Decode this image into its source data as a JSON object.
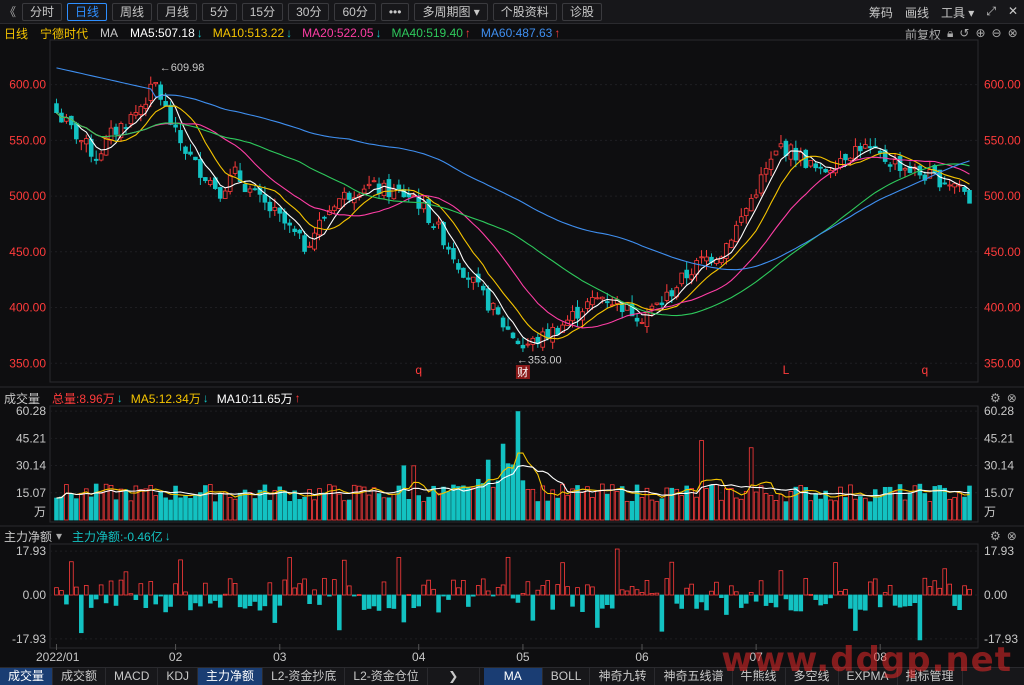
{
  "toolbar": {
    "back": "《",
    "buttons": [
      "分时",
      "日线",
      "周线",
      "月线",
      "5分",
      "15分",
      "30分",
      "60分",
      "•••",
      "多周期图",
      "个股资料",
      "诊股"
    ],
    "active": "日线",
    "right": [
      "筹码",
      "画线",
      "工具"
    ]
  },
  "main_legend": {
    "period": "日线",
    "name": "宁德时代",
    "ma": "MA",
    "ma5": "MA5:507.18",
    "ma10": "MA10:513.22",
    "ma20": "MA20:522.05",
    "ma40": "MA40:519.40",
    "ma60": "MA60:487.63",
    "adjust": "前复权"
  },
  "vol_legend": {
    "name": "成交量",
    "total": "总量:8.96万",
    "ma5": "MA5:12.34万",
    "ma10": "MA10:11.65万"
  },
  "flow_legend": {
    "name": "主力净额",
    "value": "主力净额:-0.46亿"
  },
  "tabs": [
    "成交量",
    "成交额",
    "MACD",
    "KDJ",
    "主力净额",
    "L2-资金抄底",
    "L2-资金仓位"
  ],
  "tabs_active": [
    "成交量",
    "主力净额"
  ],
  "tabs2": [
    "MA",
    "BOLL",
    "神奇九转",
    "神奇五线谱",
    "牛熊线",
    "多空线",
    "EXPMA",
    "指标管理"
  ],
  "tabs2_active": "MA",
  "watermark": "www.ddgp.net",
  "colors": {
    "up": "#ff3b3b",
    "down": "#13c2c2",
    "ma5": "#ffffff",
    "ma10": "#f5c400",
    "ma20": "#ff3ea5",
    "ma40": "#2ec95c",
    "ma60": "#3f8ff0",
    "accent": "#2e8fff"
  },
  "chart_data": [
    {
      "type": "candlestick",
      "title": "宁德时代 日线",
      "y_ticks": [
        "600.00",
        "550.00",
        "500.00",
        "450.00",
        "400.00",
        "350.00"
      ],
      "ylim": [
        335,
        640
      ],
      "x_labels": [
        "2022/01",
        "02",
        "03",
        "04",
        "05",
        "06",
        "07",
        "08"
      ],
      "annotations": {
        "high": "609.98",
        "low": "353.00",
        "markers": [
          "q",
          "财",
          "L",
          "q"
        ]
      },
      "anchors": [
        [
          0,
          575
        ],
        [
          3,
          560
        ],
        [
          8,
          535
        ],
        [
          11,
          555
        ],
        [
          16,
          575
        ],
        [
          20,
          600
        ],
        [
          24,
          555
        ],
        [
          28,
          528
        ],
        [
          33,
          505
        ],
        [
          36,
          520
        ],
        [
          40,
          500
        ],
        [
          45,
          480
        ],
        [
          50,
          455
        ],
        [
          56,
          495
        ],
        [
          62,
          510
        ],
        [
          66,
          505
        ],
        [
          72,
          500
        ],
        [
          77,
          470
        ],
        [
          81,
          440
        ],
        [
          86,
          410
        ],
        [
          90,
          385
        ],
        [
          94,
          365
        ],
        [
          98,
          373
        ],
        [
          102,
          385
        ],
        [
          106,
          400
        ],
        [
          110,
          410
        ],
        [
          114,
          402
        ],
        [
          118,
          392
        ],
        [
          122,
          405
        ],
        [
          126,
          425
        ],
        [
          130,
          442
        ],
        [
          134,
          450
        ],
        [
          138,
          480
        ],
        [
          142,
          515
        ],
        [
          146,
          545
        ],
        [
          150,
          535
        ],
        [
          154,
          520
        ],
        [
          158,
          535
        ],
        [
          162,
          545
        ],
        [
          166,
          535
        ],
        [
          170,
          528
        ],
        [
          174,
          520
        ],
        [
          178,
          515
        ],
        [
          182,
          510
        ],
        [
          184,
          497
        ]
      ]
    },
    {
      "type": "bar",
      "title": "成交量",
      "unit": "万",
      "y_ticks": [
        "60.28",
        "45.21",
        "30.14",
        "15.07"
      ],
      "ylim": [
        0,
        62
      ],
      "notes": "daily volume bars with MA5 (white) and MA10 (yellow) overlays; peak ~60 around 2022/05"
    },
    {
      "type": "bar",
      "title": "主力净额",
      "y_ticks": [
        "17.93",
        "0.00",
        "-17.93"
      ],
      "ylim": [
        -20,
        20
      ],
      "notes": "daily main-capital net inflow, red positive / cyan negative"
    }
  ]
}
